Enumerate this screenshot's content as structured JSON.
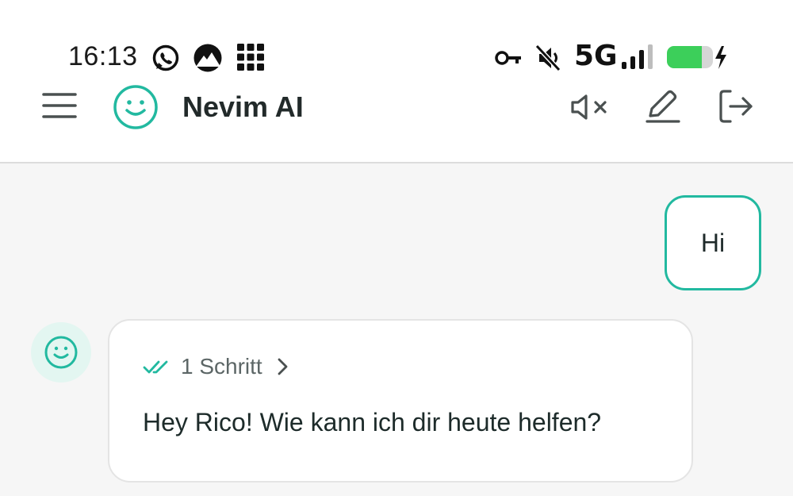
{
  "status_bar": {
    "time": "16:13",
    "network": "5G",
    "icons": [
      "whatsapp-icon",
      "vpn-mountain-icon",
      "app-grid-icon",
      "key-icon",
      "mute-icon",
      "signal-icon",
      "battery-charging-icon"
    ]
  },
  "header": {
    "title": "Nevim AI",
    "icons": [
      "menu-icon",
      "smiley-logo-icon",
      "volume-mute-icon",
      "edit-icon",
      "logout-icon"
    ]
  },
  "chat": {
    "messages": [
      {
        "role": "user",
        "text": "Hi"
      },
      {
        "role": "assistant",
        "steps_label": "1 Schritt",
        "text": "Hey Rico! Wie kann ich dir heute helfen?"
      }
    ]
  },
  "colors": {
    "accent": "#22b9a0",
    "battery": "#3ccf5a",
    "avatar_bg": "#e3f6f1",
    "background": "#f6f6f6"
  }
}
